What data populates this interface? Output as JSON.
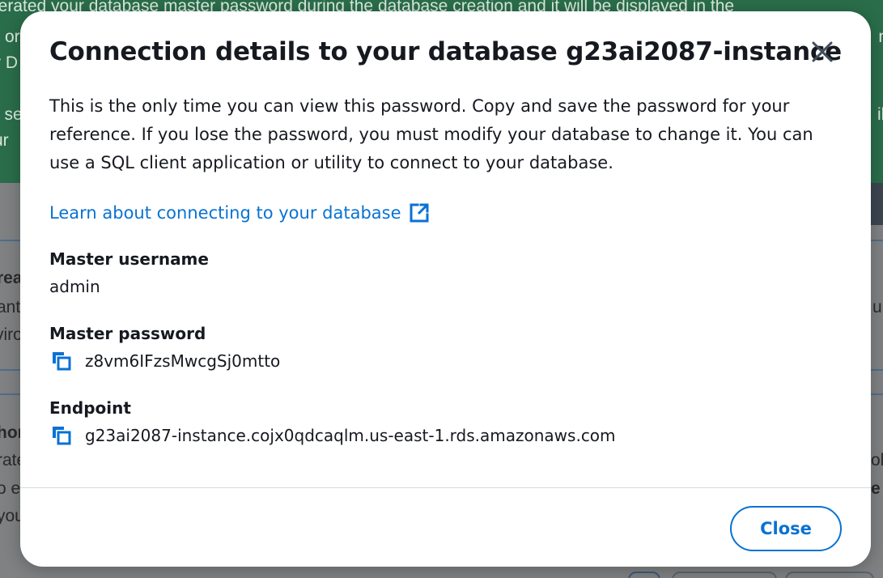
{
  "background": {
    "banner_lines": [
      "nerated your database master password during the database creation and it will be displayed in the",
      "or",
      "r D",
      "e se",
      "ur"
    ],
    "banner_right_fragments": [
      "n",
      "ile"
    ],
    "page_fragments_left": [
      "rea",
      "ant",
      "viro",
      "hor",
      "rate",
      "o e",
      "you"
    ],
    "page_fragments_right": [
      "u",
      "ol",
      "e"
    ]
  },
  "modal": {
    "title": "Connection details to your database g23ai2087-instance",
    "close_icon": "close-icon",
    "description": "This is the only time you can view this password. Copy and save the password for your reference. If you lose the password, you must modify your database to change it. You can use a SQL client application or utility to connect to your database.",
    "learn_link": {
      "label": "Learn about connecting to your database",
      "icon": "external-link-icon"
    },
    "fields": [
      {
        "label": "Master username",
        "value": "admin",
        "copyable": false
      },
      {
        "label": "Master password",
        "value": "z8vm6IFzsMwcgSj0mtto",
        "copyable": true,
        "icon": "copy-icon"
      },
      {
        "label": "Endpoint",
        "value": "g23ai2087-instance.cojx0qdcaqlm.us-east-1.rds.amazonaws.com",
        "copyable": true,
        "icon": "copy-icon"
      }
    ],
    "close_button_label": "Close"
  },
  "colors": {
    "link": "#0972d3",
    "text": "#16191f",
    "banner": "#2a6d4a",
    "overlay": "#7f8182"
  }
}
